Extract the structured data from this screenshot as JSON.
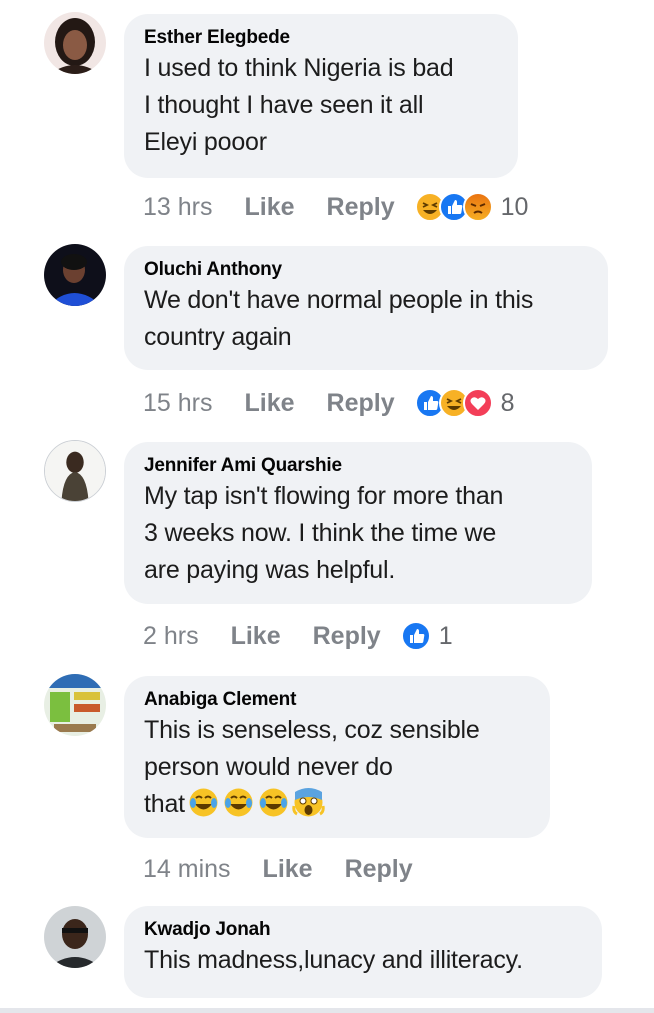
{
  "comments": [
    {
      "author": "Esther Elegbede",
      "text": "I used to think Nigeria is bad\nI thought I have seen it all\nEleyi pooor",
      "time": "13 hrs",
      "like": "Like",
      "reply": "Reply",
      "reactions": [
        "haha",
        "like",
        "angry"
      ],
      "reaction_count": "10"
    },
    {
      "author": "Oluchi Anthony",
      "text": "We don't have normal people in this\ncountry again",
      "time": "15 hrs",
      "like": "Like",
      "reply": "Reply",
      "reactions": [
        "like",
        "haha",
        "love"
      ],
      "reaction_count": "8"
    },
    {
      "author": "Jennifer Ami Quarshie",
      "text": "My tap isn't flowing for more than\n3 weeks now. I think the time we\nare paying was helpful.",
      "time": "2 hrs",
      "like": "Like",
      "reply": "Reply",
      "reactions": [
        "like"
      ],
      "reaction_count": "1"
    },
    {
      "author": "Anabiga Clement",
      "text": "This is senseless, coz sensible\nperson would never do\nthat",
      "text_emojis": [
        "tears-of-joy",
        "tears-of-joy",
        "tears-of-joy",
        "screaming-face"
      ],
      "time": "14 mins",
      "like": "Like",
      "reply": "Reply"
    },
    {
      "author": "Kwadjo Jonah",
      "text": "This madness,lunacy and illiteracy."
    }
  ],
  "colors": {
    "bubble": "#f0f2f5",
    "meta_text": "#7f8389",
    "like_blue": "#1877f2",
    "love_red": "#f33e58",
    "haha_yellow": "#f7b125",
    "angry_orange": "#e9710f"
  }
}
